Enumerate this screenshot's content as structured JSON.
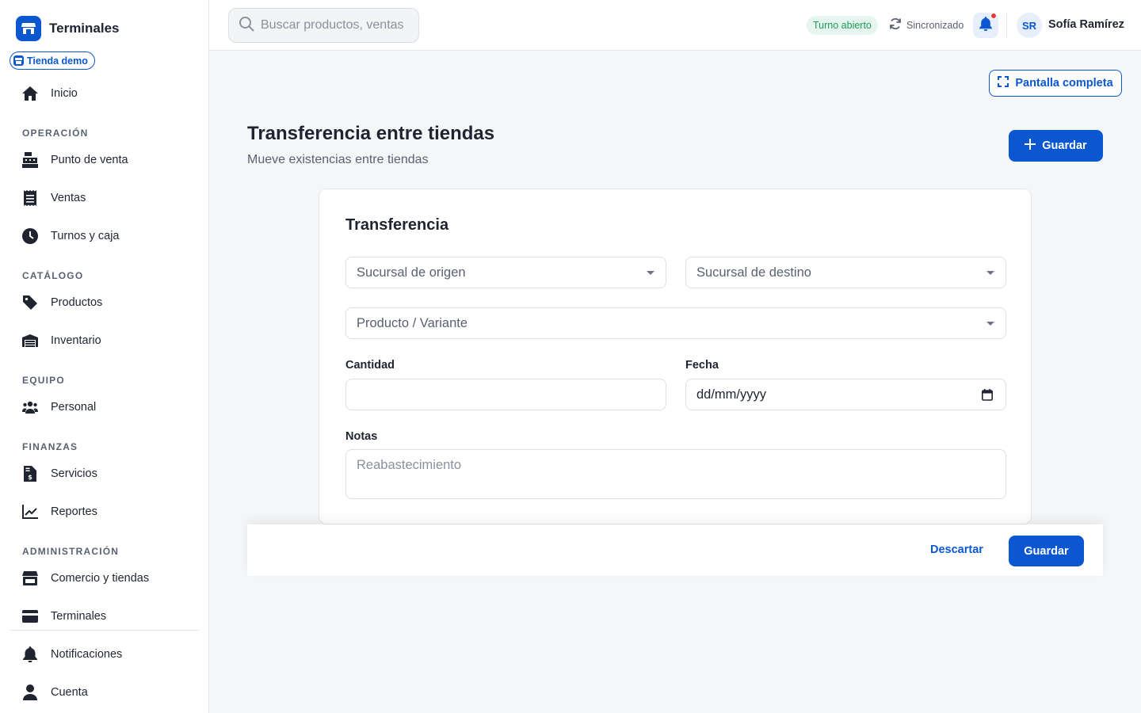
{
  "app": {
    "name": "Terminales",
    "store_badge": "Tienda demo"
  },
  "sidebar": {
    "top_item": {
      "label": "Inicio",
      "icon": "home-icon"
    },
    "sections": [
      {
        "title": "OPERACIÓN",
        "items": [
          {
            "label": "Punto de venta",
            "icon": "cash-register-icon"
          },
          {
            "label": "Ventas",
            "icon": "receipt-icon"
          },
          {
            "label": "Turnos y caja",
            "icon": "clock-icon"
          }
        ]
      },
      {
        "title": "CATÁLOGO",
        "items": [
          {
            "label": "Productos",
            "icon": "tag-icon"
          },
          {
            "label": "Inventario",
            "icon": "warehouse-icon"
          }
        ]
      },
      {
        "title": "EQUIPO",
        "items": [
          {
            "label": "Personal",
            "icon": "users-icon"
          }
        ]
      },
      {
        "title": "FINANZAS",
        "items": [
          {
            "label": "Servicios",
            "icon": "invoice-dollar-icon"
          },
          {
            "label": "Reportes",
            "icon": "line-chart-icon"
          }
        ]
      },
      {
        "title": "ADMINISTRACIÓN",
        "items": [
          {
            "label": "Comercio y tiendas",
            "icon": "store-icon"
          },
          {
            "label": "Terminales",
            "icon": "credit-card-icon"
          }
        ]
      }
    ],
    "bottom_items": [
      {
        "label": "Notificaciones",
        "icon": "bell-icon"
      },
      {
        "label": "Cuenta",
        "icon": "user-icon"
      }
    ]
  },
  "topbar": {
    "search_placeholder": "Buscar productos, ventas",
    "shift_status": "Turno abierto",
    "sync_status": "Sincronizado",
    "user_initials": "SR",
    "user_name": "Sofía Ramírez"
  },
  "page": {
    "fullscreen_label": "Pantalla completa",
    "title": "Transferencia entre tiendas",
    "subtitle": "Mueve existencias entre tiendas",
    "save_label": "Guardar"
  },
  "form": {
    "card_title": "Transferencia",
    "origin_placeholder": "Sucursal de origen",
    "destination_placeholder": "Sucursal de destino",
    "product_placeholder": "Producto / Variante",
    "quantity_label": "Cantidad",
    "quantity_value": "",
    "date_label": "Fecha",
    "date_value": "dd/mm/yyyy",
    "notes_label": "Notas",
    "notes_placeholder": "Reabastecimiento"
  },
  "footer": {
    "discard_label": "Descartar",
    "save_label": "Guardar"
  },
  "colors": {
    "primary": "#0b57d0",
    "success": "#1e9a5a",
    "alert": "#e53935"
  }
}
